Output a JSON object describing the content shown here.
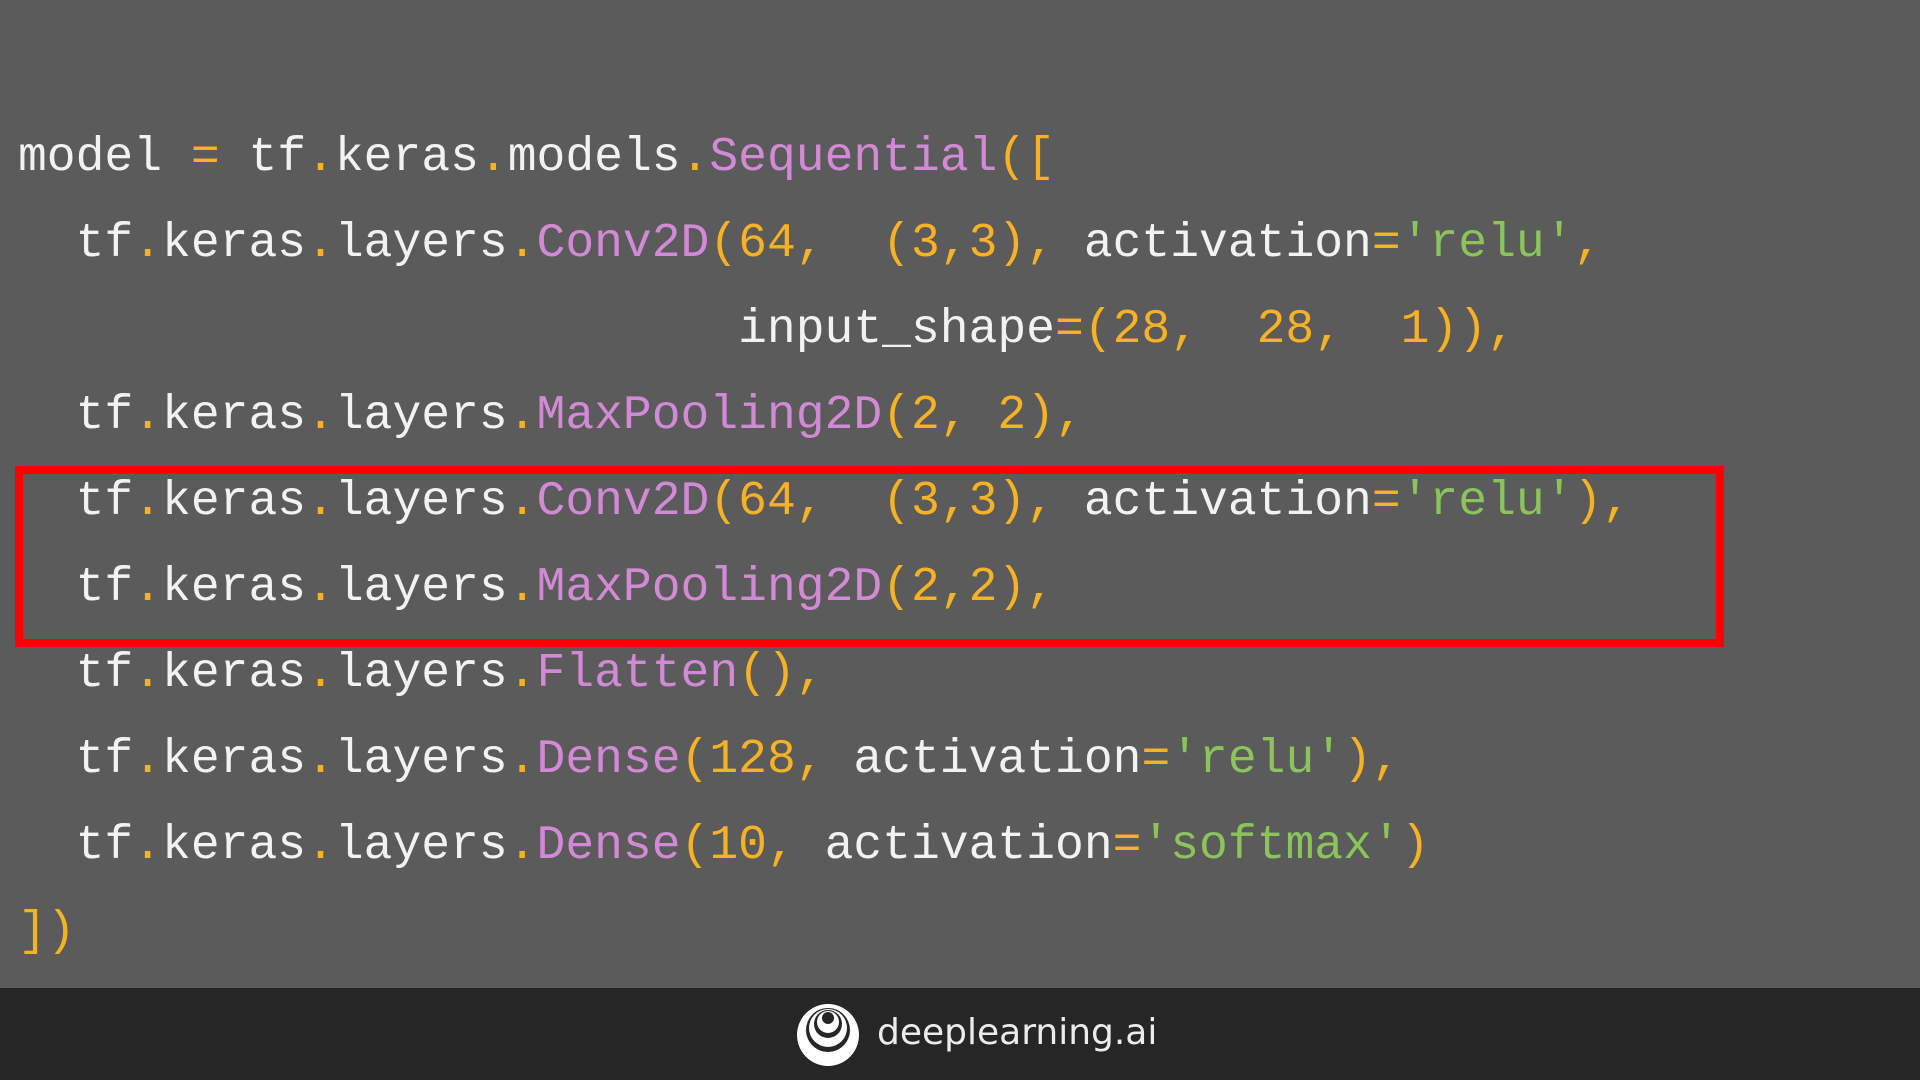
{
  "code": {
    "lines": [
      [
        [
          "id",
          "model "
        ],
        [
          "punc",
          "="
        ],
        [
          "id",
          " tf"
        ],
        [
          "punc",
          "."
        ],
        [
          "id",
          "keras"
        ],
        [
          "punc",
          "."
        ],
        [
          "id",
          "models"
        ],
        [
          "punc",
          "."
        ],
        [
          "cls",
          "Sequential"
        ],
        [
          "punc",
          "(["
        ]
      ],
      [
        [
          "id",
          "  tf"
        ],
        [
          "punc",
          "."
        ],
        [
          "id",
          "keras"
        ],
        [
          "punc",
          "."
        ],
        [
          "id",
          "layers"
        ],
        [
          "punc",
          "."
        ],
        [
          "cls",
          "Conv2D"
        ],
        [
          "punc",
          "("
        ],
        [
          "num",
          "64"
        ],
        [
          "punc",
          ", "
        ],
        [
          "punc",
          " (3,3), "
        ],
        [
          "id",
          "activation"
        ],
        [
          "punc",
          "="
        ],
        [
          "str",
          "'relu'"
        ],
        [
          "punc",
          ","
        ]
      ],
      [
        [
          "id",
          "                         input_shape"
        ],
        [
          "punc",
          "=("
        ],
        [
          "num",
          "28"
        ],
        [
          "punc",
          ", "
        ],
        [
          "num",
          " 28"
        ],
        [
          "punc",
          ", "
        ],
        [
          "num",
          " 1"
        ],
        [
          "punc",
          ")),"
        ]
      ],
      [
        [
          "id",
          "  tf"
        ],
        [
          "punc",
          "."
        ],
        [
          "id",
          "keras"
        ],
        [
          "punc",
          "."
        ],
        [
          "id",
          "layers"
        ],
        [
          "punc",
          "."
        ],
        [
          "cls",
          "MaxPooling2D"
        ],
        [
          "punc",
          "("
        ],
        [
          "num",
          "2"
        ],
        [
          "punc",
          ", "
        ],
        [
          "num",
          "2"
        ],
        [
          "punc",
          "),"
        ]
      ],
      [
        [
          "id",
          "  tf"
        ],
        [
          "punc",
          "."
        ],
        [
          "id",
          "keras"
        ],
        [
          "punc",
          "."
        ],
        [
          "id",
          "layers"
        ],
        [
          "punc",
          "."
        ],
        [
          "cls",
          "Conv2D"
        ],
        [
          "punc",
          "("
        ],
        [
          "num",
          "64"
        ],
        [
          "punc",
          ", "
        ],
        [
          "punc",
          " (3,3), "
        ],
        [
          "id",
          "activation"
        ],
        [
          "punc",
          "="
        ],
        [
          "str",
          "'relu'"
        ],
        [
          "punc",
          "),"
        ]
      ],
      [
        [
          "id",
          "  tf"
        ],
        [
          "punc",
          "."
        ],
        [
          "id",
          "keras"
        ],
        [
          "punc",
          "."
        ],
        [
          "id",
          "layers"
        ],
        [
          "punc",
          "."
        ],
        [
          "cls",
          "MaxPooling2D"
        ],
        [
          "punc",
          "("
        ],
        [
          "num",
          "2"
        ],
        [
          "punc",
          ","
        ],
        [
          "num",
          "2"
        ],
        [
          "punc",
          "),"
        ]
      ],
      [
        [
          "id",
          "  tf"
        ],
        [
          "punc",
          "."
        ],
        [
          "id",
          "keras"
        ],
        [
          "punc",
          "."
        ],
        [
          "id",
          "layers"
        ],
        [
          "punc",
          "."
        ],
        [
          "cls",
          "Flatten"
        ],
        [
          "punc",
          "(),"
        ]
      ],
      [
        [
          "id",
          "  tf"
        ],
        [
          "punc",
          "."
        ],
        [
          "id",
          "keras"
        ],
        [
          "punc",
          "."
        ],
        [
          "id",
          "layers"
        ],
        [
          "punc",
          "."
        ],
        [
          "cls",
          "Dense"
        ],
        [
          "punc",
          "("
        ],
        [
          "num",
          "128"
        ],
        [
          "punc",
          ", "
        ],
        [
          "id",
          "activation"
        ],
        [
          "punc",
          "="
        ],
        [
          "str",
          "'relu'"
        ],
        [
          "punc",
          "),"
        ]
      ],
      [
        [
          "id",
          "  tf"
        ],
        [
          "punc",
          "."
        ],
        [
          "id",
          "keras"
        ],
        [
          "punc",
          "."
        ],
        [
          "id",
          "layers"
        ],
        [
          "punc",
          "."
        ],
        [
          "cls",
          "Dense"
        ],
        [
          "punc",
          "("
        ],
        [
          "num",
          "10"
        ],
        [
          "punc",
          ", "
        ],
        [
          "id",
          "activation"
        ],
        [
          "punc",
          "="
        ],
        [
          "str",
          "'softmax'"
        ],
        [
          "punc",
          ")"
        ]
      ],
      [
        [
          "punc",
          "])"
        ]
      ]
    ],
    "highlighted_lines": [
      5,
      6
    ]
  },
  "colors": {
    "background": "#5b5b5b",
    "highlight_box": "#ff0000",
    "footer": "#262626"
  },
  "footer": {
    "logo_icon": "deeplearning-ai-logo",
    "brand": "deeplearning.ai"
  }
}
